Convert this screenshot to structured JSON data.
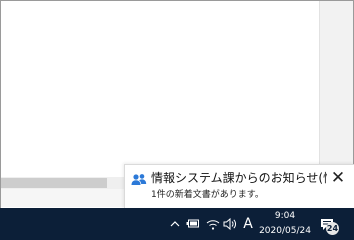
{
  "notification": {
    "title": "情報システム課からのお知らせ(情報シ",
    "body": "1件の新着文書があります。",
    "close_glyph": "✕",
    "icon": "people-icon"
  },
  "taskbar": {
    "ime_label": "A",
    "time": "9:04",
    "date": "2020/05/24",
    "notification_count": "24",
    "icons": [
      "chevron-up-icon",
      "battery-icon",
      "wifi-icon",
      "volume-icon",
      "action-center-icon"
    ]
  },
  "colors": {
    "taskbar": "#0c1f38",
    "toast_icon": "#2b79d8"
  }
}
